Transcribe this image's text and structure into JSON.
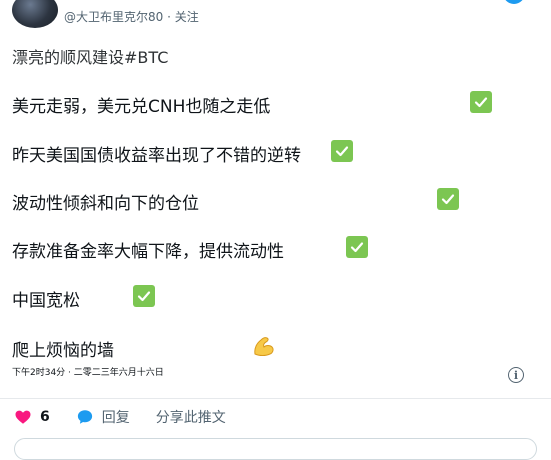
{
  "tweet": {
    "handle": "@大卫布里克尔80 · 关注",
    "hashtag_line": "漂亮的顺风建设#BTC",
    "lines": [
      "美元走弱，美元兑CNH也随之走低",
      "昨天美国国债收益率出现了不错的逆转",
      "波动性倾斜和向下的仓位",
      "存款准备金率大幅下降，提供流动性",
      "中国宽松",
      "爬上烦恼的墙"
    ],
    "timestamp": "下午2时34分 · 二零二三年六月十六日"
  },
  "actions": {
    "like_count": "6",
    "reply_label": "回复",
    "share_label": "分享此推文"
  },
  "icons": {
    "check": "white-check-mark-icon",
    "muscle": "flexed-biceps-icon",
    "info": "info-icon",
    "heart": "heart-icon",
    "reply": "speech-bubble-icon"
  },
  "colors": {
    "check_green": "#7cc652",
    "heart_pink": "#f91880",
    "reply_blue": "#1d9bf0"
  }
}
